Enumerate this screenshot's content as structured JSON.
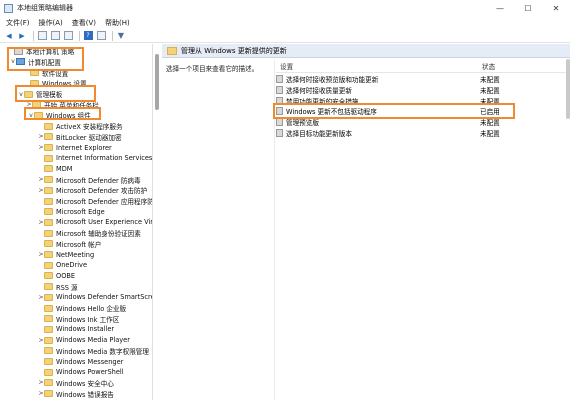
{
  "window": {
    "title": "本地组策略编辑器",
    "min_glyph": "—",
    "max_glyph": "☐",
    "close_glyph": "✕"
  },
  "menu": [
    "文件(F)",
    "操作(A)",
    "查看(V)",
    "帮助(H)"
  ],
  "toolbar": {
    "back_glyph": "◀",
    "forward_glyph": "▶",
    "help_glyph": "?"
  },
  "tree": {
    "items": [
      {
        "label": "本地计算机 策略",
        "expand": "",
        "icon": "policy-icon"
      },
      {
        "label": "计算机配置",
        "expand": "v",
        "icon": "pc-icon"
      },
      {
        "label": "软件设置",
        "expand": "",
        "icon": "folder-icon"
      },
      {
        "label": "Windows 设置",
        "expand": "",
        "icon": "folder-icon"
      },
      {
        "label": "管理模板",
        "expand": "v",
        "icon": "folder-icon"
      },
      {
        "label": "开始 菜单和任务栏",
        "expand": ">",
        "icon": "folder-icon"
      },
      {
        "label": "Windows 组件",
        "expand": "v",
        "icon": "folder-icon"
      },
      {
        "label": "ActiveX 安装程序服务",
        "expand": "",
        "icon": "folder-icon"
      },
      {
        "label": "BitLocker 驱动器加密",
        "expand": ">",
        "icon": "folder-icon"
      },
      {
        "label": "Internet Explorer",
        "expand": ">",
        "icon": "folder-icon"
      },
      {
        "label": "Internet Information Services",
        "expand": "",
        "icon": "folder-icon"
      },
      {
        "label": "MDM",
        "expand": "",
        "icon": "folder-icon"
      },
      {
        "label": "Microsoft Defender 防病毒",
        "expand": ">",
        "icon": "folder-icon"
      },
      {
        "label": "Microsoft Defender 攻击防护",
        "expand": ">",
        "icon": "folder-icon"
      },
      {
        "label": "Microsoft Defender 应用程序防",
        "expand": "",
        "icon": "folder-icon"
      },
      {
        "label": "Microsoft Edge",
        "expand": "",
        "icon": "folder-icon"
      },
      {
        "label": "Microsoft User Experience Vir",
        "expand": ">",
        "icon": "folder-icon"
      },
      {
        "label": "Microsoft 辅助身份验证因素",
        "expand": "",
        "icon": "folder-icon"
      },
      {
        "label": "Microsoft 帐户",
        "expand": "",
        "icon": "folder-icon"
      },
      {
        "label": "NetMeeting",
        "expand": ">",
        "icon": "folder-icon"
      },
      {
        "label": "OneDrive",
        "expand": "",
        "icon": "folder-icon"
      },
      {
        "label": "OOBE",
        "expand": "",
        "icon": "folder-icon"
      },
      {
        "label": "RSS 源",
        "expand": "",
        "icon": "folder-icon"
      },
      {
        "label": "Windows Defender SmartScre",
        "expand": ">",
        "icon": "folder-icon"
      },
      {
        "label": "Windows Hello 企业版",
        "expand": "",
        "icon": "folder-icon"
      },
      {
        "label": "Windows Ink 工作区",
        "expand": "",
        "icon": "folder-icon"
      },
      {
        "label": "Windows Installer",
        "expand": "",
        "icon": "folder-icon"
      },
      {
        "label": "Windows Media Player",
        "expand": ">",
        "icon": "folder-icon"
      },
      {
        "label": "Windows Media 数字权限管理",
        "expand": "",
        "icon": "folder-icon"
      },
      {
        "label": "Windows Messenger",
        "expand": "",
        "icon": "folder-icon"
      },
      {
        "label": "Windows PowerShell",
        "expand": "",
        "icon": "folder-icon"
      },
      {
        "label": "Windows 安全中心",
        "expand": ">",
        "icon": "folder-icon"
      },
      {
        "label": "Windows 错误报告",
        "expand": ">",
        "icon": "folder-icon"
      }
    ]
  },
  "right": {
    "header": "管理从 Windows 更新提供的更新",
    "description": "选择一个项目来查看它的描述。",
    "col_setting": "设置",
    "col_state": "状态",
    "rows": [
      {
        "name": "选择何时接收预览版和功能更新",
        "state": "未配置"
      },
      {
        "name": "选择何时接收质量更新",
        "state": "未配置"
      },
      {
        "name": "禁用功能更新的安全措施",
        "state": "未配置"
      },
      {
        "name": "Windows 更新不包括驱动程序",
        "state": "已启用"
      },
      {
        "name": "管理预览版",
        "state": "未配置"
      },
      {
        "name": "选择目标功能更新版本",
        "state": "未配置"
      }
    ]
  },
  "colors": {
    "highlight": "#ef8a2f",
    "header_bg": "#e6ecf5"
  }
}
